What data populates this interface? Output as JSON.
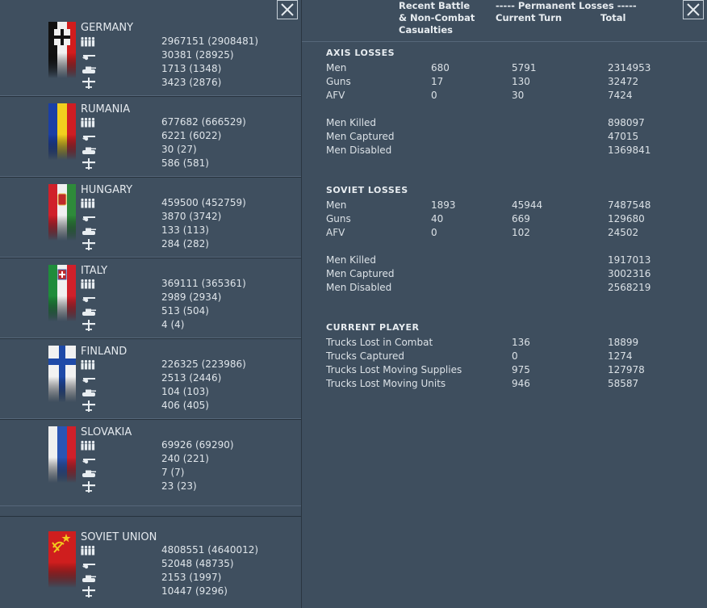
{
  "nations": [
    {
      "name": "GERMANY",
      "flag": "germany",
      "men": "2967151 (2908481)",
      "guns": "30381 (28925)",
      "afv": "1713 (1348)",
      "aircraft": "3423 (2876)"
    },
    {
      "name": "RUMANIA",
      "flag": "rumania",
      "men": "677682 (666529)",
      "guns": "6221 (6022)",
      "afv": "30 (27)",
      "aircraft": "586 (581)"
    },
    {
      "name": "HUNGARY",
      "flag": "hungary",
      "men": "459500 (452759)",
      "guns": "3870 (3742)",
      "afv": "133 (113)",
      "aircraft": "284 (282)"
    },
    {
      "name": "ITALY",
      "flag": "italy",
      "men": "369111 (365361)",
      "guns": "2989 (2934)",
      "afv": "513 (504)",
      "aircraft": "4 (4)"
    },
    {
      "name": "FINLAND",
      "flag": "finland",
      "men": "226325 (223986)",
      "guns": "2513 (2446)",
      "afv": "104 (103)",
      "aircraft": "406 (405)"
    },
    {
      "name": "SLOVAKIA",
      "flag": "slovakia",
      "men": "69926 (69290)",
      "guns": "240 (221)",
      "afv": "7 (7)",
      "aircraft": "23 (23)"
    },
    {
      "name": "SOVIET UNION",
      "flag": "soviet",
      "men": "4808551 (4640012)",
      "guns": "52048 (48735)",
      "afv": "2153 (1997)",
      "aircraft": "10447 (9296)"
    }
  ],
  "header": {
    "recent_line1": "Recent Battle",
    "recent_line2": "& Non-Combat",
    "recent_line3": "Casualties",
    "permanent": "----- Permanent Losses -----",
    "current_turn": "Current Turn",
    "total": "Total"
  },
  "axis": {
    "title": "AXIS LOSSES",
    "rows": [
      {
        "label": "Men",
        "recent": "680",
        "turn": "5791",
        "total": "2314953"
      },
      {
        "label": "Guns",
        "recent": "17",
        "turn": "130",
        "total": "32472"
      },
      {
        "label": "AFV",
        "recent": "0",
        "turn": "30",
        "total": "7424"
      }
    ],
    "details": [
      {
        "label": "Men Killed",
        "total": "898097"
      },
      {
        "label": "Men Captured",
        "total": "47015"
      },
      {
        "label": "Men Disabled",
        "total": "1369841"
      }
    ]
  },
  "soviet": {
    "title": "SOVIET LOSSES",
    "rows": [
      {
        "label": "Men",
        "recent": "1893",
        "turn": "45944",
        "total": "7487548"
      },
      {
        "label": "Guns",
        "recent": "40",
        "turn": "669",
        "total": "129680"
      },
      {
        "label": "AFV",
        "recent": "0",
        "turn": "102",
        "total": "24502"
      }
    ],
    "details": [
      {
        "label": "Men Killed",
        "total": "1917013"
      },
      {
        "label": "Men Captured",
        "total": "3002316"
      },
      {
        "label": "Men Disabled",
        "total": "2568219"
      }
    ]
  },
  "player": {
    "title": "CURRENT PLAYER",
    "rows": [
      {
        "label": "Trucks Lost in Combat",
        "turn": "136",
        "total": "18899"
      },
      {
        "label": "Trucks Captured",
        "turn": "0",
        "total": "1274"
      },
      {
        "label": "Trucks Lost Moving Supplies",
        "turn": "975",
        "total": "127978"
      },
      {
        "label": "Trucks Lost Moving Units",
        "turn": "946",
        "total": "58587"
      }
    ]
  },
  "icons": {
    "close": "close-icon",
    "men": "soldiers-icon",
    "guns": "gun-icon",
    "afv": "tank-icon",
    "aircraft": "aircraft-icon"
  },
  "colors": {
    "background": "#3e4e5e",
    "text": "#d8dee4",
    "border": "#c7d0d8"
  }
}
